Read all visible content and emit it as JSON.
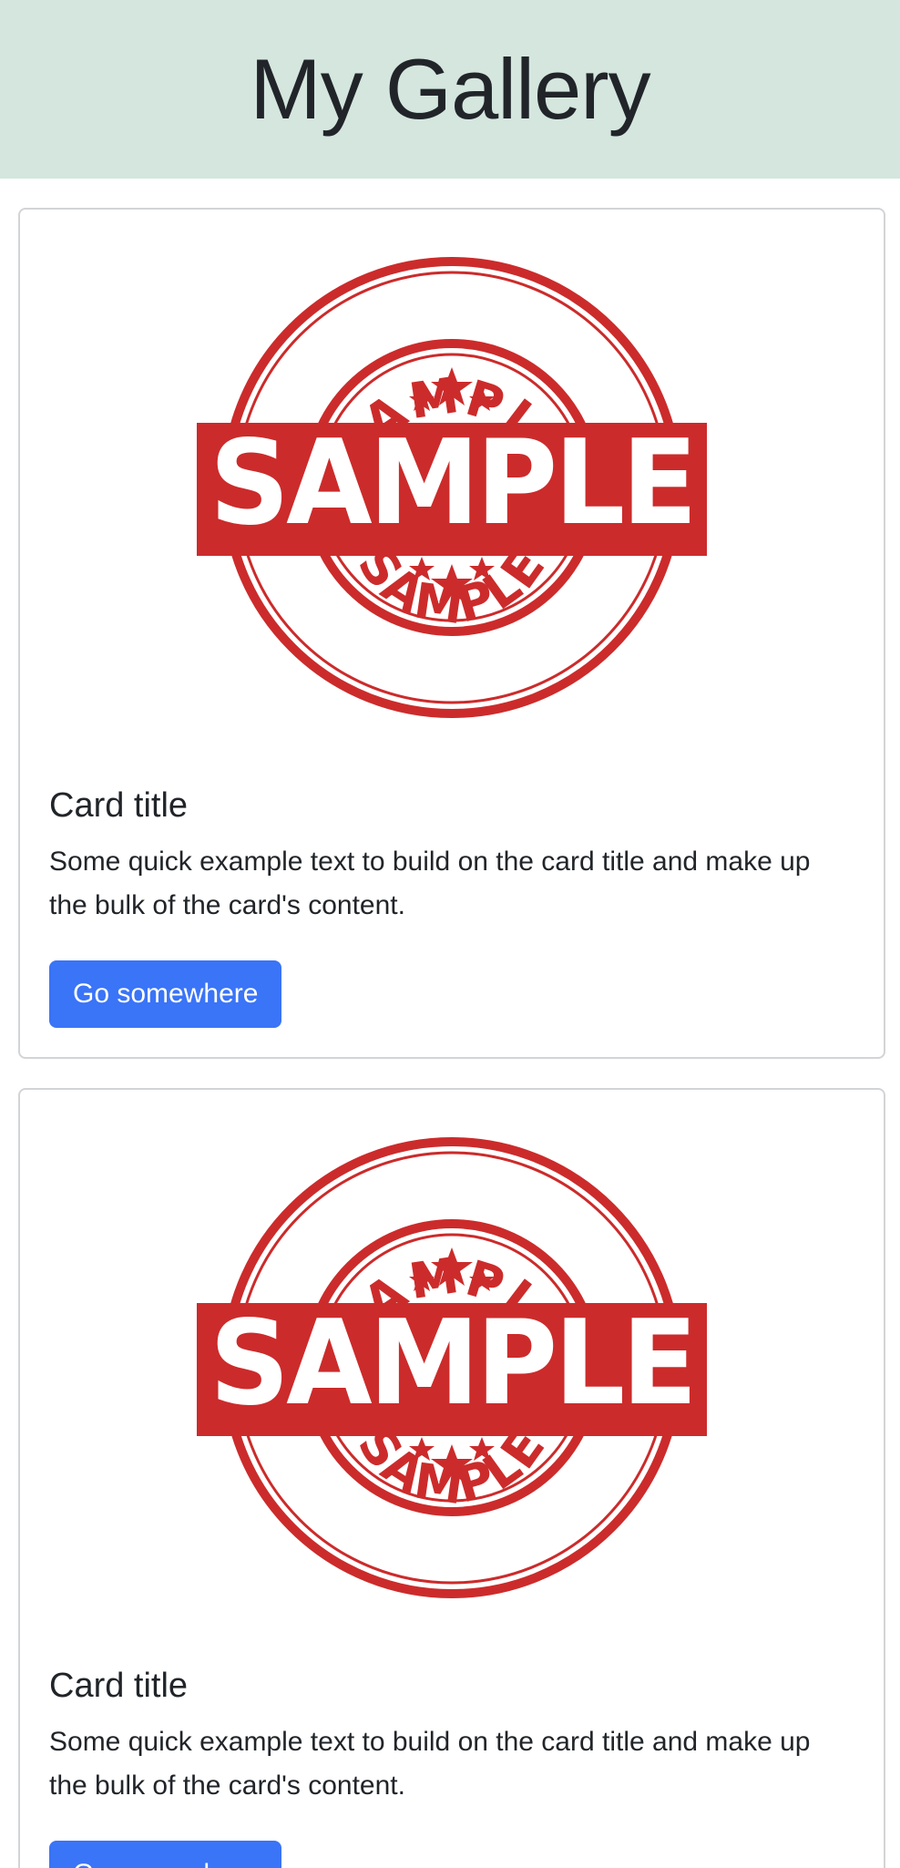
{
  "header": {
    "title": "My Gallery"
  },
  "colors": {
    "header_bg": "#d4e6de",
    "stamp_red": "#cc2b2b",
    "button_primary": "#3a74f7"
  },
  "cards": [
    {
      "image_label": "SAMPLE",
      "image_icon": "sample-stamp-icon",
      "title": "Card title",
      "text": "Some quick example text to build on the card title and make up the bulk of the card's content.",
      "button_label": "Go somewhere"
    },
    {
      "image_label": "SAMPLE",
      "image_icon": "sample-stamp-icon",
      "title": "Card title",
      "text": "Some quick example text to build on the card title and make up the bulk of the card's content.",
      "button_label": "Go somewhere"
    }
  ]
}
